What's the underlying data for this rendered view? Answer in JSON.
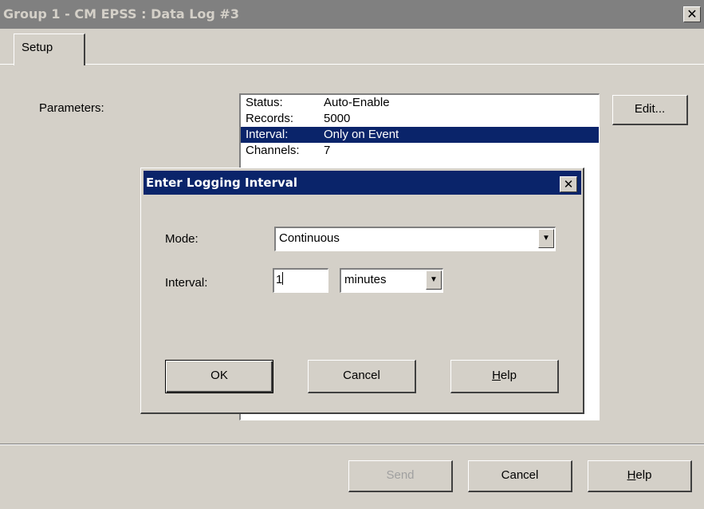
{
  "window": {
    "title": "Group 1 - CM EPSS : Data Log #3",
    "close_glyph": "✕"
  },
  "tabs": [
    {
      "label": "Setup"
    }
  ],
  "parameters": {
    "label": "Parameters:",
    "rows": [
      {
        "key": "Status:",
        "value": "Auto-Enable"
      },
      {
        "key": "Records:",
        "value": "5000"
      },
      {
        "key": "Interval:",
        "value": "Only on Event",
        "selected": true
      },
      {
        "key": "Channels:",
        "value": "7"
      }
    ],
    "edit_label": "Edit..."
  },
  "footer": {
    "send_label": "Send",
    "cancel_label": "Cancel",
    "help_label": "Help",
    "help_mnemonic": "H",
    "help_rest": "elp"
  },
  "dialog": {
    "title": "Enter Logging Interval",
    "close_glyph": "✕",
    "mode_label": "Mode:",
    "mode_value": "Continuous",
    "interval_label": "Interval:",
    "interval_value": "1",
    "unit_value": "minutes",
    "ok_label": "OK",
    "cancel_label": "Cancel",
    "help_mnemonic": "H",
    "help_rest": "elp"
  },
  "colors": {
    "face": "#d4d0c8",
    "inactive_title": "#808080",
    "active_title": "#0a246a",
    "selection": "#0a246a"
  },
  "icons": {
    "dropdown": "chevron-down-icon",
    "close": "close-icon"
  }
}
